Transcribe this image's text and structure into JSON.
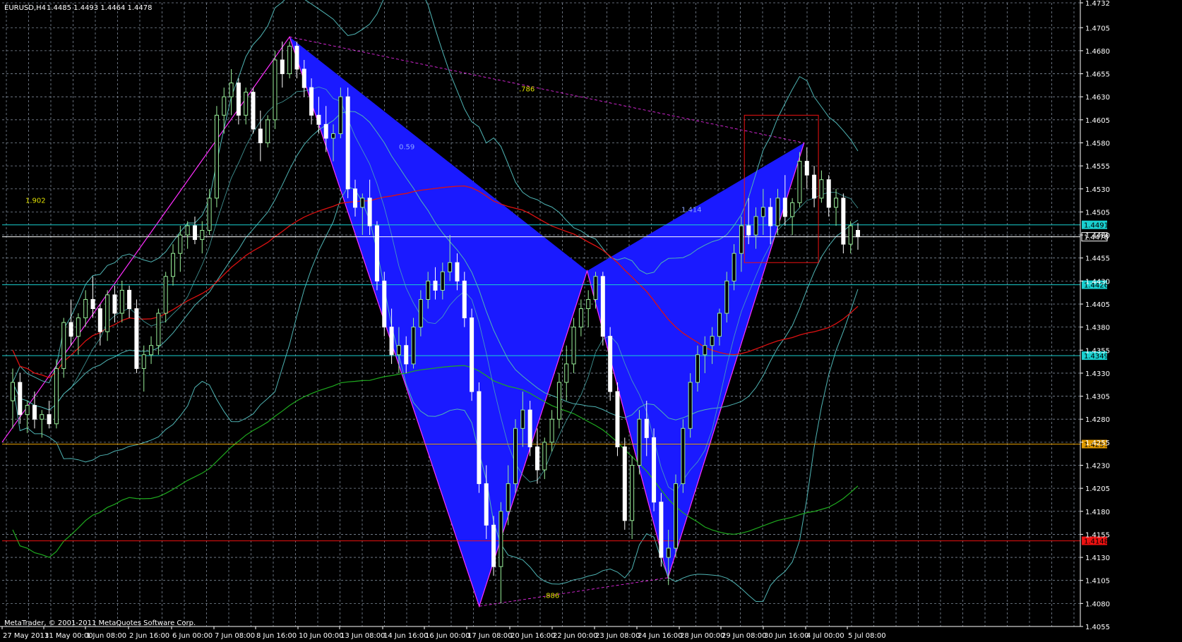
{
  "header": {
    "symbol": "EURUSD,H4",
    "ohlc": "1.4485 1.4493 1.4464 1.4478"
  },
  "footer": {
    "copyright": "MetaTrader, © 2001-2011 MetaQuotes Software Corp."
  },
  "colors": {
    "background": "#000000",
    "grid": "#7f8a99",
    "axis": "#ffffff",
    "bull": "#99ee99",
    "bear": "#ffffff",
    "pattern_fill": "#1a1aff",
    "pattern_edge": "#ff2eff",
    "ma_red": "#dd1111",
    "ma_green": "#1faa1f",
    "bands": "#4fb4b4",
    "hline_cyan": "#19d0d0",
    "hline_red": "#ee1111",
    "hline_orange": "#e09a00"
  },
  "chart_data": {
    "type": "candlestick",
    "timeframe": "H4",
    "ylim": [
      1.4055,
      1.4732
    ],
    "x_tick_labels": [
      "27 May 2011",
      "31 May 00:00",
      "1 Jun 08:00",
      "2 Jun 16:00",
      "6 Jun 00:00",
      "7 Jun 08:00",
      "8 Jun 16:00",
      "10 Jun 00:00",
      "13 Jun 08:00",
      "14 Jun 16:00",
      "16 Jun 00:00",
      "17 Jun 08:00",
      "20 Jun 16:00",
      "22 Jun 00:00",
      "23 Jun 08:00",
      "24 Jun 16:00",
      "28 Jun 00:00",
      "29 Jun 08:00",
      "30 Jun 16:00",
      "4 Jul 00:00",
      "5 Jul 08:00"
    ],
    "y_tick_labels": [
      "1.4732",
      "1.4705",
      "1.4680",
      "1.4655",
      "1.4630",
      "1.4605",
      "1.4580",
      "1.4555",
      "1.4530",
      "1.4505",
      "1.4480",
      "1.4455",
      "1.4430",
      "1.4405",
      "1.4380",
      "1.4355",
      "1.4330",
      "1.4305",
      "1.4280",
      "1.4255",
      "1.4230",
      "1.4205",
      "1.4180",
      "1.4155",
      "1.4130",
      "1.4105",
      "1.4080",
      "1.4055"
    ],
    "candles": [
      [
        1.43,
        1.4335,
        1.427,
        1.432
      ],
      [
        1.432,
        1.433,
        1.4275,
        1.4285
      ],
      [
        1.4285,
        1.43,
        1.4265,
        1.4295
      ],
      [
        1.4295,
        1.431,
        1.427,
        1.428
      ],
      [
        1.428,
        1.429,
        1.426,
        1.4285
      ],
      [
        1.4285,
        1.43,
        1.427,
        1.4275
      ],
      [
        1.4275,
        1.4345,
        1.427,
        1.4335
      ],
      [
        1.4335,
        1.439,
        1.4325,
        1.4385
      ],
      [
        1.4385,
        1.441,
        1.436,
        1.437
      ],
      [
        1.437,
        1.4395,
        1.435,
        1.439
      ],
      [
        1.439,
        1.442,
        1.438,
        1.441
      ],
      [
        1.441,
        1.4435,
        1.439,
        1.44
      ],
      [
        1.44,
        1.4405,
        1.436,
        1.4375
      ],
      [
        1.4375,
        1.442,
        1.4365,
        1.4415
      ],
      [
        1.4415,
        1.4425,
        1.4385,
        1.4395
      ],
      [
        1.4395,
        1.443,
        1.4385,
        1.442
      ],
      [
        1.442,
        1.4425,
        1.439,
        1.44
      ],
      [
        1.44,
        1.441,
        1.433,
        1.4335
      ],
      [
        1.4335,
        1.436,
        1.431,
        1.435
      ],
      [
        1.435,
        1.437,
        1.434,
        1.436
      ],
      [
        1.436,
        1.44,
        1.435,
        1.4395
      ],
      [
        1.4395,
        1.444,
        1.4385,
        1.4435
      ],
      [
        1.4435,
        1.447,
        1.4425,
        1.446
      ],
      [
        1.446,
        1.449,
        1.444,
        1.448
      ],
      [
        1.448,
        1.4495,
        1.4465,
        1.449
      ],
      [
        1.449,
        1.45,
        1.447,
        1.4475
      ],
      [
        1.4475,
        1.4495,
        1.446,
        1.4485
      ],
      [
        1.4485,
        1.453,
        1.448,
        1.452
      ],
      [
        1.452,
        1.462,
        1.451,
        1.461
      ],
      [
        1.461,
        1.464,
        1.459,
        1.463
      ],
      [
        1.463,
        1.466,
        1.461,
        1.4645
      ],
      [
        1.4645,
        1.465,
        1.46,
        1.461
      ],
      [
        1.461,
        1.464,
        1.46,
        1.4635
      ],
      [
        1.4635,
        1.464,
        1.459,
        1.4595
      ],
      [
        1.4595,
        1.4615,
        1.456,
        1.458
      ],
      [
        1.458,
        1.461,
        1.4575,
        1.4605
      ],
      [
        1.4605,
        1.468,
        1.4595,
        1.467
      ],
      [
        1.467,
        1.469,
        1.464,
        1.4655
      ],
      [
        1.4655,
        1.469,
        1.465,
        1.4685
      ],
      [
        1.4685,
        1.469,
        1.465,
        1.466
      ],
      [
        1.466,
        1.467,
        1.463,
        1.464
      ],
      [
        1.464,
        1.465,
        1.46,
        1.461
      ],
      [
        1.461,
        1.463,
        1.459,
        1.46
      ],
      [
        1.46,
        1.462,
        1.457,
        1.4585
      ],
      [
        1.4585,
        1.46,
        1.456,
        1.459
      ],
      [
        1.459,
        1.464,
        1.4585,
        1.463
      ],
      [
        1.463,
        1.464,
        1.452,
        1.453
      ],
      [
        1.453,
        1.454,
        1.45,
        1.451
      ],
      [
        1.451,
        1.4525,
        1.448,
        1.452
      ],
      [
        1.452,
        1.454,
        1.448,
        1.449
      ],
      [
        1.449,
        1.4495,
        1.442,
        1.443
      ],
      [
        1.443,
        1.444,
        1.437,
        1.438
      ],
      [
        1.438,
        1.44,
        1.434,
        1.435
      ],
      [
        1.435,
        1.438,
        1.433,
        1.436
      ],
      [
        1.436,
        1.437,
        1.433,
        1.434
      ],
      [
        1.434,
        1.439,
        1.4335,
        1.438
      ],
      [
        1.438,
        1.442,
        1.437,
        1.441
      ],
      [
        1.441,
        1.444,
        1.44,
        1.443
      ],
      [
        1.443,
        1.4445,
        1.441,
        1.442
      ],
      [
        1.442,
        1.445,
        1.441,
        1.444
      ],
      [
        1.444,
        1.448,
        1.443,
        1.445
      ],
      [
        1.445,
        1.446,
        1.442,
        1.443
      ],
      [
        1.443,
        1.444,
        1.438,
        1.439
      ],
      [
        1.439,
        1.44,
        1.43,
        1.431
      ],
      [
        1.431,
        1.432,
        1.42,
        1.421
      ],
      [
        1.421,
        1.423,
        1.415,
        1.4165
      ],
      [
        1.4165,
        1.4175,
        1.411,
        1.412
      ],
      [
        1.412,
        1.419,
        1.408,
        1.418
      ],
      [
        1.418,
        1.423,
        1.4165,
        1.421
      ],
      [
        1.421,
        1.428,
        1.42,
        1.427
      ],
      [
        1.427,
        1.431,
        1.425,
        1.429
      ],
      [
        1.429,
        1.43,
        1.424,
        1.425
      ],
      [
        1.425,
        1.427,
        1.421,
        1.4225
      ],
      [
        1.4225,
        1.426,
        1.4215,
        1.4255
      ],
      [
        1.4255,
        1.429,
        1.4245,
        1.428
      ],
      [
        1.428,
        1.433,
        1.427,
        1.432
      ],
      [
        1.432,
        1.436,
        1.43,
        1.434
      ],
      [
        1.434,
        1.439,
        1.433,
        1.438
      ],
      [
        1.438,
        1.441,
        1.437,
        1.44
      ],
      [
        1.44,
        1.442,
        1.438,
        1.441
      ],
      [
        1.441,
        1.444,
        1.44,
        1.4435
      ],
      [
        1.4435,
        1.444,
        1.436,
        1.437
      ],
      [
        1.437,
        1.438,
        1.43,
        1.431
      ],
      [
        1.431,
        1.432,
        1.424,
        1.425
      ],
      [
        1.425,
        1.426,
        1.416,
        1.417
      ],
      [
        1.417,
        1.424,
        1.415,
        1.423
      ],
      [
        1.423,
        1.429,
        1.422,
        1.428
      ],
      [
        1.428,
        1.43,
        1.424,
        1.426
      ],
      [
        1.426,
        1.427,
        1.418,
        1.419
      ],
      [
        1.419,
        1.42,
        1.412,
        1.413
      ],
      [
        1.413,
        1.416,
        1.41,
        1.414
      ],
      [
        1.414,
        1.422,
        1.413,
        1.421
      ],
      [
        1.421,
        1.428,
        1.42,
        1.427
      ],
      [
        1.427,
        1.433,
        1.426,
        1.432
      ],
      [
        1.432,
        1.436,
        1.431,
        1.435
      ],
      [
        1.435,
        1.437,
        1.433,
        1.436
      ],
      [
        1.436,
        1.438,
        1.434,
        1.437
      ],
      [
        1.437,
        1.44,
        1.436,
        1.4395
      ],
      [
        1.4395,
        1.444,
        1.4385,
        1.443
      ],
      [
        1.443,
        1.447,
        1.442,
        1.446
      ],
      [
        1.446,
        1.45,
        1.444,
        1.449
      ],
      [
        1.449,
        1.452,
        1.447,
        1.448
      ],
      [
        1.448,
        1.451,
        1.4465,
        1.45
      ],
      [
        1.45,
        1.453,
        1.448,
        1.451
      ],
      [
        1.451,
        1.452,
        1.447,
        1.449
      ],
      [
        1.449,
        1.453,
        1.448,
        1.452
      ],
      [
        1.452,
        1.4545,
        1.449,
        1.45
      ],
      [
        1.45,
        1.452,
        1.448,
        1.4515
      ],
      [
        1.4515,
        1.457,
        1.451,
        1.456
      ],
      [
        1.456,
        1.4575,
        1.453,
        1.4545
      ],
      [
        1.4545,
        1.4555,
        1.451,
        1.452
      ],
      [
        1.452,
        1.455,
        1.4515,
        1.454
      ],
      [
        1.454,
        1.4545,
        1.45,
        1.451
      ],
      [
        1.451,
        1.453,
        1.449,
        1.452
      ],
      [
        1.452,
        1.4525,
        1.446,
        1.447
      ],
      [
        1.447,
        1.4495,
        1.446,
        1.449
      ],
      [
        1.4485,
        1.4493,
        1.4464,
        1.4478
      ]
    ],
    "horizontal_levels": [
      {
        "price": 1.4491,
        "label": "1.4491",
        "color": "cyan"
      },
      {
        "price": 1.4478,
        "label": "1.4478",
        "color": "white"
      },
      {
        "price": 1.4426,
        "label": "1.4426",
        "color": "cyan"
      },
      {
        "price": 1.4349,
        "label": "1.4349",
        "color": "cyan"
      },
      {
        "price": 1.4253,
        "label": "1.4253",
        "color": "orange"
      },
      {
        "price": 1.4148,
        "label": "1.4148",
        "color": "red"
      }
    ],
    "annotations": [
      "1.902",
      "0.59",
      ".786",
      "1.414",
      ".886"
    ],
    "pattern": "harmonic (X-A-B-C-D, two blue triangles)"
  }
}
